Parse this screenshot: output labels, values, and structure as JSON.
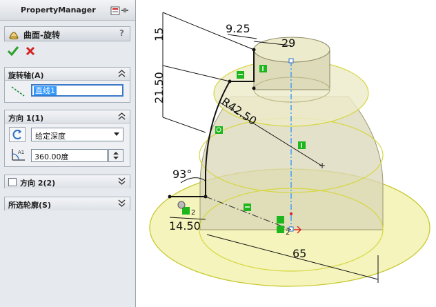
{
  "property_manager": {
    "title": "PropertyManager",
    "feature_title": "曲面-旋转",
    "help": "?",
    "axis_section": {
      "title": "旋转轴(A)",
      "value": "直线1"
    },
    "direction1": {
      "title": "方向 1(1)",
      "type": "给定深度",
      "angle": "360.00度"
    },
    "direction2": {
      "title": "方向 2(2)"
    },
    "selected_contours": {
      "title": "所选轮廓(S)"
    }
  },
  "dimensions": {
    "d15": "15",
    "d925": "9.25",
    "d29": "29",
    "d2150": "21.50",
    "r4250": "R42.50",
    "a93": "93°",
    "d1450": "14.50",
    "d65": "65",
    "rel_count": "2"
  },
  "colors": {
    "accent_blue": "#3399ff",
    "ok_green": "#2ca02c",
    "cancel_red": "#d62020",
    "surface_yellow": "#f2f2b0",
    "relation_green": "#1db61d"
  }
}
